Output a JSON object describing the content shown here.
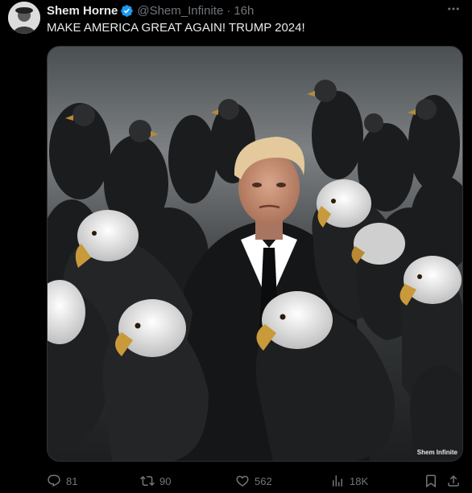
{
  "tweet": {
    "display_name": "Shem Horne",
    "handle": "@Shem_Infinite",
    "separator": "·",
    "time": "16h",
    "text": "MAKE AMERICA GREAT AGAIN! TRUMP 2024!",
    "verified": true
  },
  "media": {
    "watermark": "Shem Infinite"
  },
  "actions": {
    "replies": "81",
    "retweets": "90",
    "likes": "562",
    "views": "18K"
  },
  "icons": {
    "more": "more-options-icon",
    "reply": "reply-icon",
    "retweet": "retweet-icon",
    "like": "heart-icon",
    "views": "views-bar-chart-icon",
    "bookmark": "bookmark-icon",
    "share": "share-icon",
    "verified": "verified-badge-icon"
  },
  "colors": {
    "background": "#000000",
    "text": "#e7e9ea",
    "muted": "#71767b",
    "verified": "#1d9bf0"
  }
}
